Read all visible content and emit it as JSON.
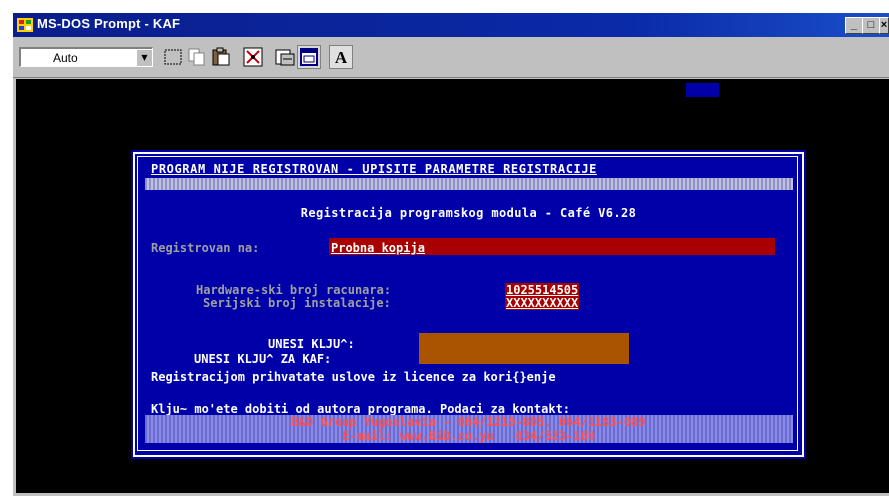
{
  "window": {
    "title": "MS-DOS Prompt - KAF",
    "minimize_glyph": "_",
    "maximize_glyph": "□",
    "close_glyph": "×"
  },
  "toolbar": {
    "font_size_value": "Auto",
    "font_button_label": "A",
    "tools": [
      "mark-icon",
      "copy-icon",
      "paste-icon",
      "fullscreen-icon",
      "properties-icon",
      "background-icon",
      "font-icon"
    ]
  },
  "dos": {
    "header": "PROGRAM NIJE REGISTROVAN - UPISITE PARAMETRE REGISTRACIJE",
    "subtitle": "Registracija programskog modula - Café V6.28",
    "registered_to_label": "Registrovan na:",
    "registered_to_value": "Probna kopija",
    "hardware_label": "Hardware-ski broj racunara:",
    "hardware_value": "1025514505",
    "serial_label": "Serijski broj instalacije:",
    "serial_value": "XXXXXXXXXX",
    "key_label": "UNESI KLJU^:",
    "kaf_key_label": "UNESI KLJU^ ZA KAF:",
    "license_text": "Registracijom prihvatate uslove iz licence za kori{}enje",
    "contact_text": "Klju~ mo'ete dobiti od autora programa. Podaci za kontakt:",
    "company_line": "B&D Group Yugoslavia - 064/1219-805, 064/1183-089",
    "email_line": "E-mail: www.BiD.co.yu   034/323-169"
  },
  "colors": {
    "title_bar": "#0a2aa8",
    "dos_background": "#000000",
    "dialog_blue": "#0000a8",
    "field_red": "#a80000",
    "key_field_brown": "#a85400",
    "contact_band": "#7a7adc",
    "contact_text_red": "#ff5050"
  }
}
